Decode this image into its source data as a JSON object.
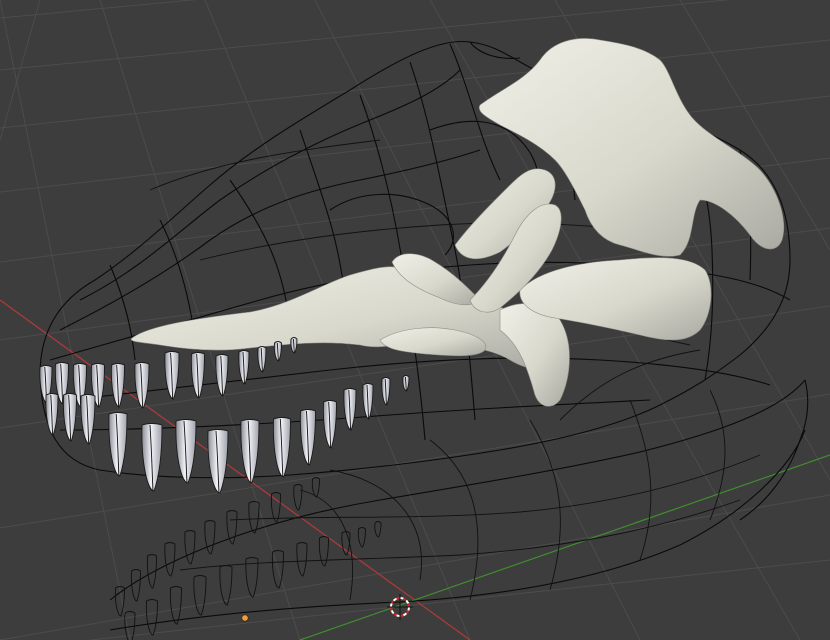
{
  "viewport": {
    "background_color": "#3d3d3d",
    "grid_color": "#4c4c4c",
    "x_axis_color": "#b23a3a",
    "y_axis_color": "#3e8e2e",
    "wireframe_color": "#0a0a0a",
    "bone_color": "#ddddd2",
    "tooth_color": "#d7d9e3"
  },
  "objects": [
    {
      "name": "skull-wireframe",
      "display": "wireframe"
    },
    {
      "name": "skull-bones",
      "display": "solid"
    },
    {
      "name": "upper-teeth",
      "display": "solid"
    },
    {
      "name": "lower-teeth",
      "display": "wireframe"
    }
  ],
  "markers": {
    "origin_dot_color": "#f0a030",
    "cursor_3d": "3d-cursor-icon"
  }
}
